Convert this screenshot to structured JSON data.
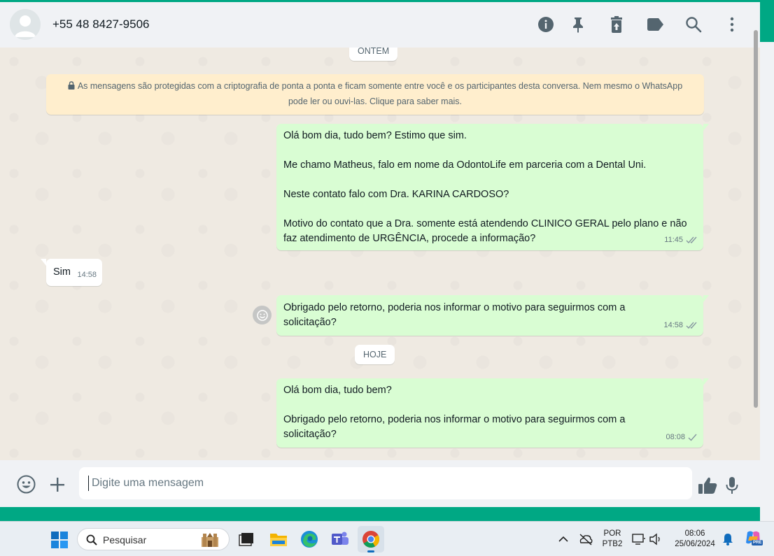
{
  "header": {
    "contact_name": "+55 48 8427-9506",
    "icons": [
      "info-icon",
      "pin-icon",
      "clear-chat-icon",
      "label-icon",
      "search-icon",
      "menu-icon"
    ]
  },
  "chat": {
    "date_top": "ONTEM",
    "encryption_notice": "As mensagens são protegidas com a criptografia de ponta a ponta e ficam somente entre você e os participantes desta conversa. Nem mesmo o WhatsApp pode ler ou ouvi-las. Clique para saber mais.",
    "messages": [
      {
        "direction": "out",
        "lines": [
          "Olá bom dia, tudo bem? Estimo que sim.",
          "Me chamo Matheus, falo em nome da OdontoLife em parceria com a Dental Uni.",
          "Neste contato falo com Dra. KARINA CARDOSO?",
          "Motivo do contato que a Dra. somente está atendendo CLINICO GERAL pelo plano e não faz atendimento de URGÊNCIA, procede a informação?"
        ],
        "time": "11:45",
        "status": "read"
      },
      {
        "direction": "in",
        "lines": [
          "Sim"
        ],
        "time": "14:58"
      },
      {
        "direction": "out",
        "lines": [
          "Obrigado pelo retorno, poderia nos informar o motivo para seguirmos com a solicitação?"
        ],
        "time": "14:58",
        "status": "read"
      },
      {
        "direction": "out",
        "lines": [
          "Olá bom dia, tudo bem?",
          "Obrigado pelo retorno, poderia nos informar o motivo para seguirmos com a solicitação?"
        ],
        "time": "08:08",
        "status": "sent"
      }
    ],
    "date_today": "HOJE"
  },
  "composer": {
    "placeholder": "Digite uma mensagem"
  },
  "taskbar": {
    "search_placeholder": "Pesquisar",
    "lang_top": "POR",
    "lang_bottom": "PTB2",
    "time": "08:06",
    "date": "25/06/2024",
    "copilot_badge": "PRE"
  },
  "colors": {
    "accent": "#00a884",
    "outgoing_bubble": "#d9fdd3",
    "incoming_bubble": "#ffffff",
    "notice_bg": "#ffeecd",
    "read_ticks": "#8696a0"
  }
}
